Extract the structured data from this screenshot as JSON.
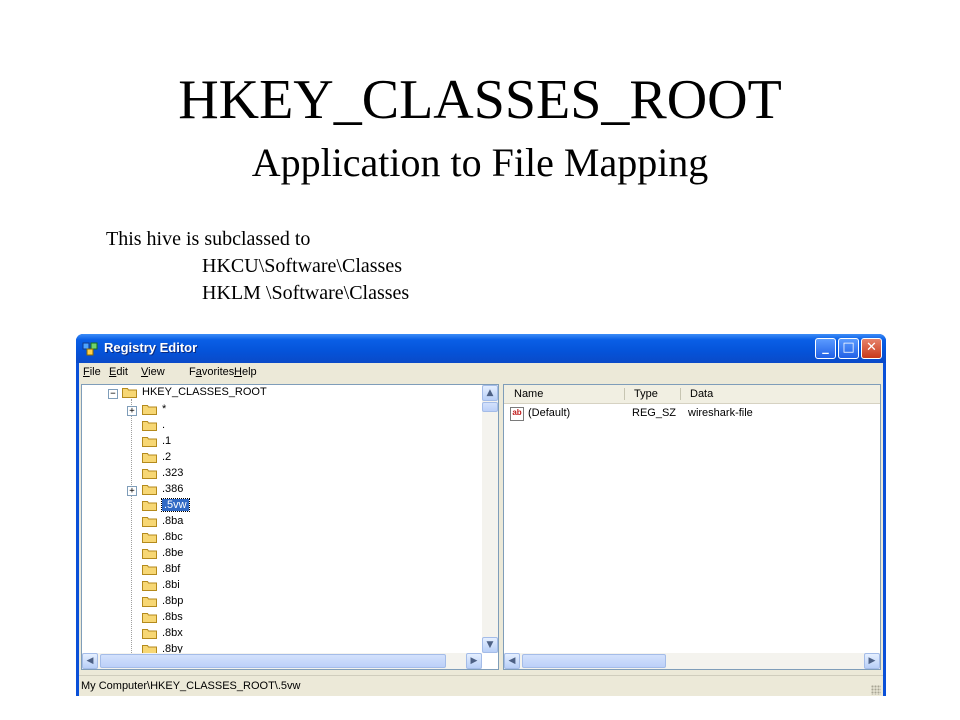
{
  "slide": {
    "title": "HKEY_CLASSES_ROOT",
    "subtitle": "Application to File Mapping",
    "body_line1": "This hive is subclassed to",
    "body_line2": "HKCU\\Software\\Classes",
    "body_line3": "HKLM \\Software\\Classes"
  },
  "window": {
    "title": "Registry Editor",
    "minimize_glyph": "_",
    "maximize_glyph": "□",
    "close_glyph": "✕",
    "app_icon": "registry-icon",
    "colors": {
      "titlebar": "#0553d9",
      "client": "#ece9d8",
      "selection": "#316ac5"
    }
  },
  "menu": [
    {
      "label_ul": "F",
      "label_rest": "ile"
    },
    {
      "label_ul": "E",
      "label_rest": "dit"
    },
    {
      "label_ul": "V",
      "label_rest": "iew"
    },
    {
      "label_pre": "F",
      "label_ul": "a",
      "label_rest": "vorites"
    },
    {
      "label_ul": "H",
      "label_rest": "elp"
    }
  ],
  "tree": {
    "root": "HKEY_CLASSES_ROOT",
    "items": [
      {
        "label": "*",
        "expandable": true
      },
      {
        "label": ".",
        "expandable": false
      },
      {
        "label": ".1",
        "expandable": false
      },
      {
        "label": ".2",
        "expandable": false
      },
      {
        "label": ".323",
        "expandable": false
      },
      {
        "label": ".386",
        "expandable": true
      },
      {
        "label": ".5vw",
        "expandable": false,
        "selected": true
      },
      {
        "label": ".8ba",
        "expandable": false
      },
      {
        "label": ".8bc",
        "expandable": false
      },
      {
        "label": ".8be",
        "expandable": false
      },
      {
        "label": ".8bf",
        "expandable": false
      },
      {
        "label": ".8bi",
        "expandable": false
      },
      {
        "label": ".8bp",
        "expandable": false
      },
      {
        "label": ".8bs",
        "expandable": false
      },
      {
        "label": ".8bx",
        "expandable": false
      },
      {
        "label": ".8by",
        "expandable": false
      }
    ]
  },
  "list": {
    "columns": [
      "Name",
      "Type",
      "Data"
    ],
    "rows": [
      {
        "icon": "string-value-icon",
        "icon_text": "ab",
        "name": "(Default)",
        "type": "REG_SZ",
        "data": "wireshark-file"
      }
    ]
  },
  "scroll": {
    "up": "▲",
    "down": "▼",
    "left": "◀",
    "right": "▶"
  },
  "status": "My Computer\\HKEY_CLASSES_ROOT\\.5vw"
}
